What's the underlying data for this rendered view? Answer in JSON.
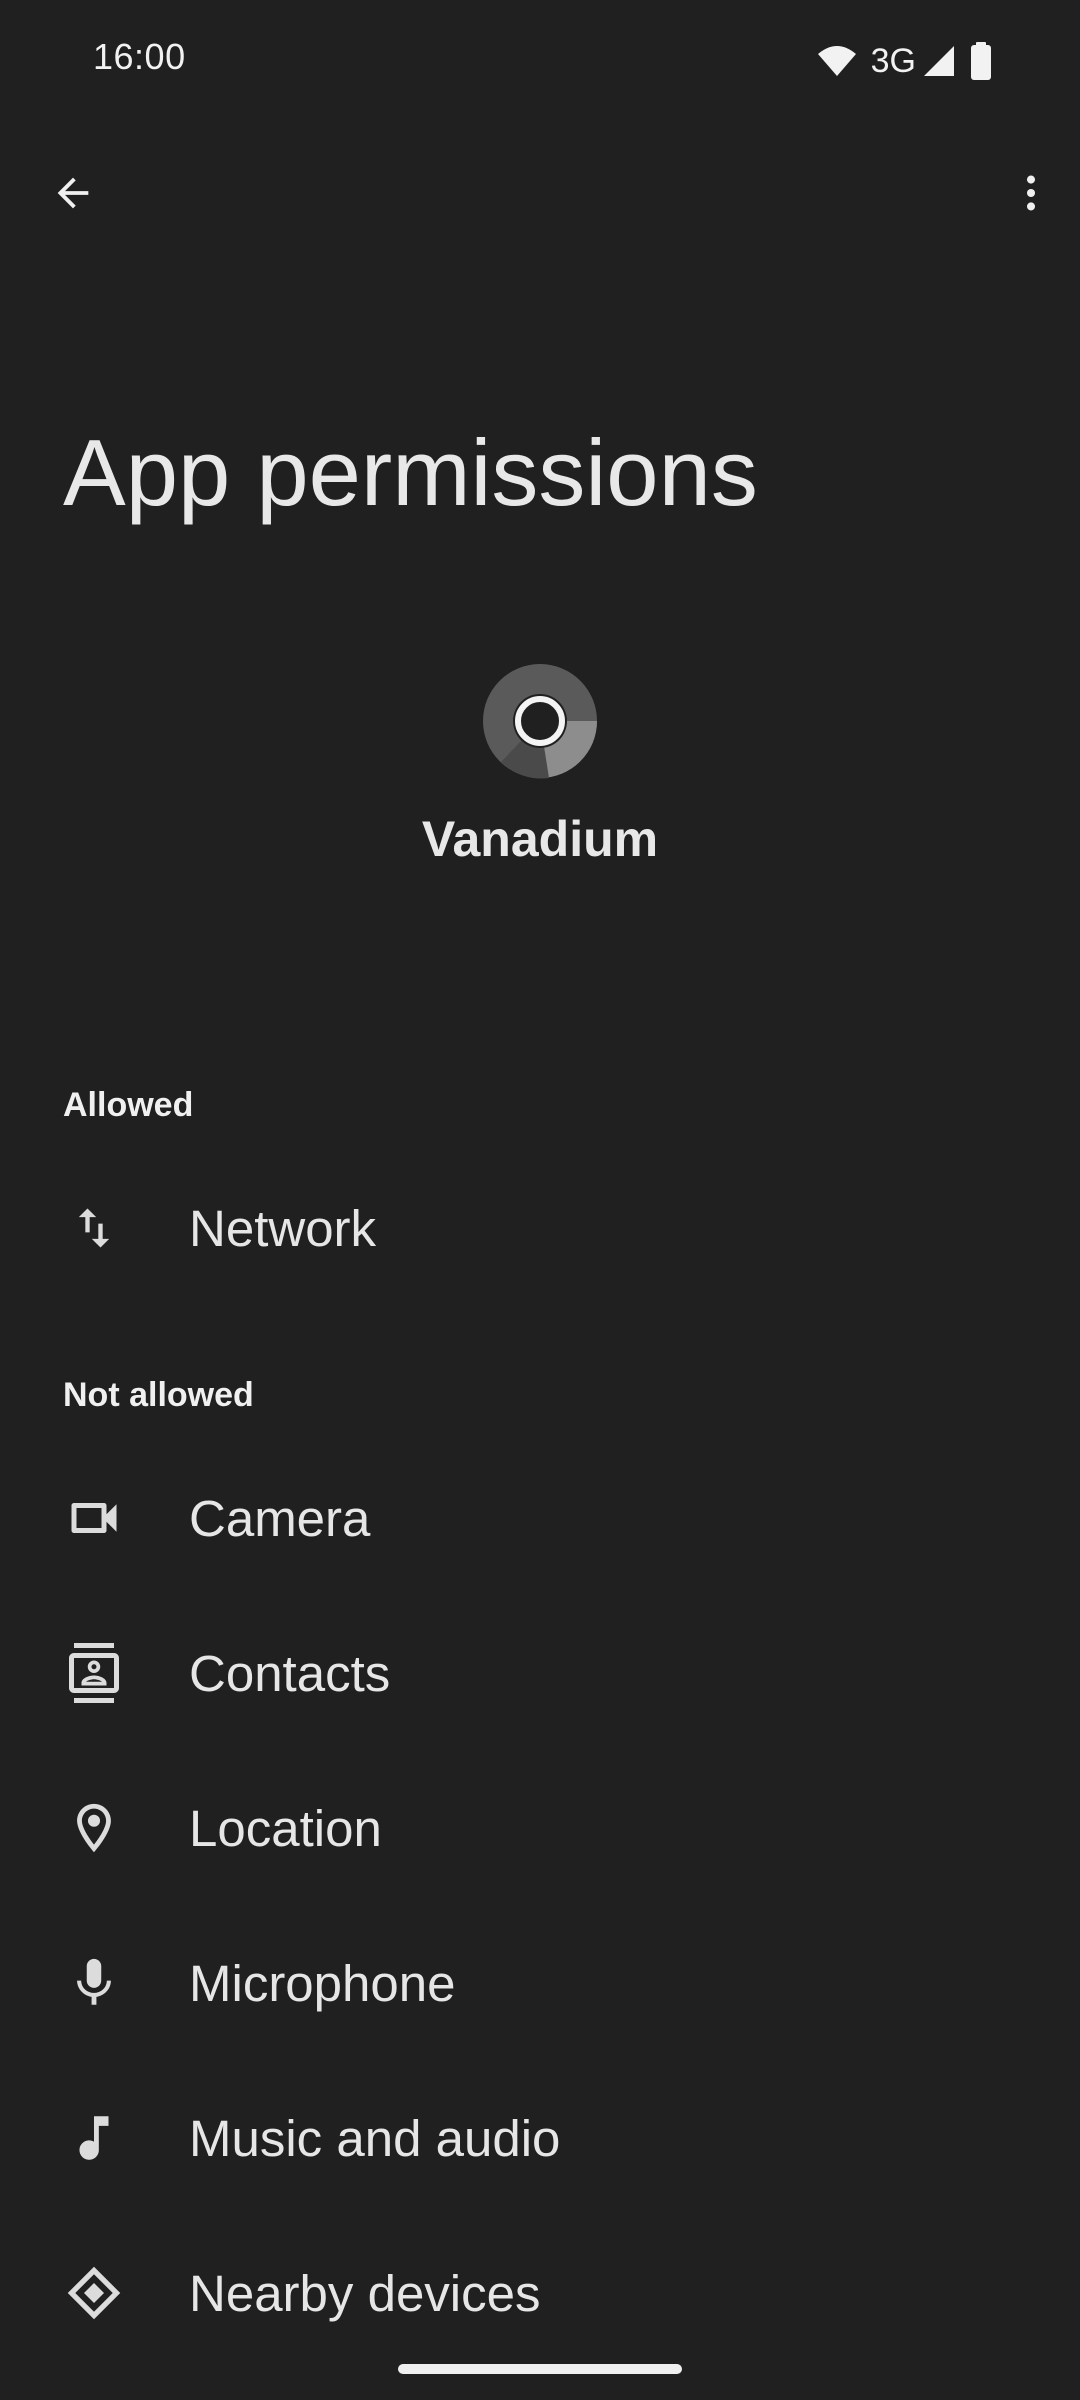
{
  "status_bar": {
    "time": "16:00",
    "network_type": "3G",
    "icons": [
      "wifi-icon",
      "signal-icon",
      "battery-icon"
    ]
  },
  "toolbar": {
    "back_icon": "arrow-left-icon",
    "more_icon": "more-vert-icon"
  },
  "page": {
    "title": "App permissions"
  },
  "app": {
    "name": "Vanadium",
    "icon": "vanadium-logo"
  },
  "sections": {
    "allowed": {
      "header": "Allowed",
      "items": [
        {
          "label": "Network",
          "icon": "swap-vert-icon"
        }
      ]
    },
    "not_allowed": {
      "header": "Not allowed",
      "items": [
        {
          "label": "Camera",
          "icon": "videocam-icon"
        },
        {
          "label": "Contacts",
          "icon": "contacts-icon"
        },
        {
          "label": "Location",
          "icon": "location-pin-icon"
        },
        {
          "label": "Microphone",
          "icon": "microphone-icon"
        },
        {
          "label": "Music and audio",
          "icon": "music-note-icon"
        },
        {
          "label": "Nearby devices",
          "icon": "nearby-devices-icon"
        }
      ]
    }
  },
  "colors": {
    "background": "#202020",
    "text_primary": "#e6e6e6"
  }
}
